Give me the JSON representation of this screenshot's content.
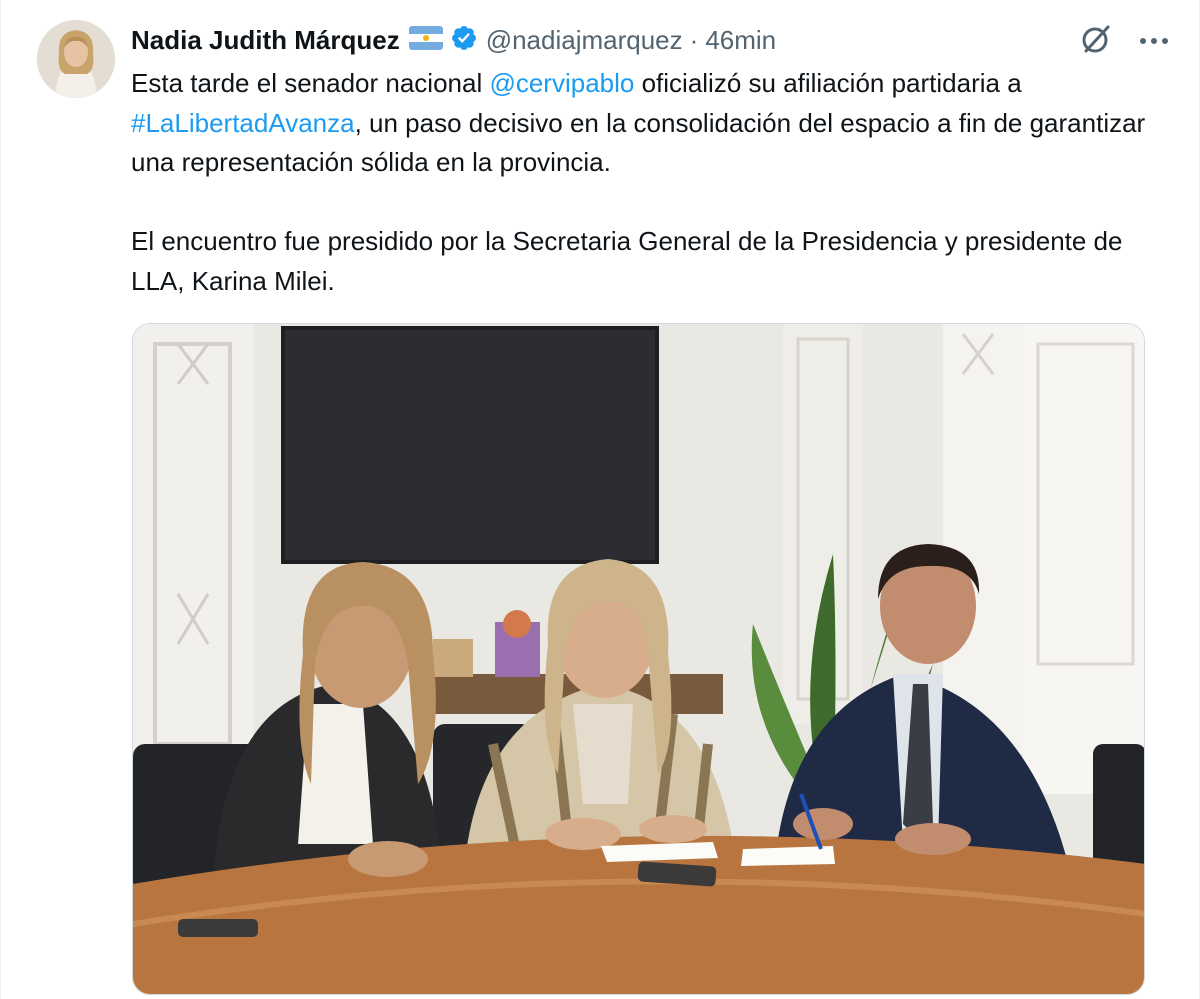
{
  "author": {
    "display_name": "Nadia Judith Márquez",
    "flag": "argentina-flag-emoji",
    "verified": true,
    "handle": "@nadiajmarquez",
    "separator": "·",
    "timestamp": "46min"
  },
  "actions": {
    "grok_icon": "grok-icon",
    "more_icon": "more-icon"
  },
  "tweet": {
    "p1_a": "Esta tarde el senador nacional ",
    "p1_mention": "@cervipablo",
    "p1_b": " oficializó su afiliación partidaria a ",
    "p1_hashtag": "#LaLibertadAvanza",
    "p1_c": ", un paso decisivo en la consolidación del espacio a fin de garantizar una representación sólida en la provincia.",
    "p2": "El encuentro fue presidido por la Secretaria General de la Presidencia y presidente de LLA, Karina Milei."
  },
  "colors": {
    "text": "#0f1419",
    "secondary": "#536471",
    "link": "#1d9bf0",
    "border": "#cfd9de"
  }
}
